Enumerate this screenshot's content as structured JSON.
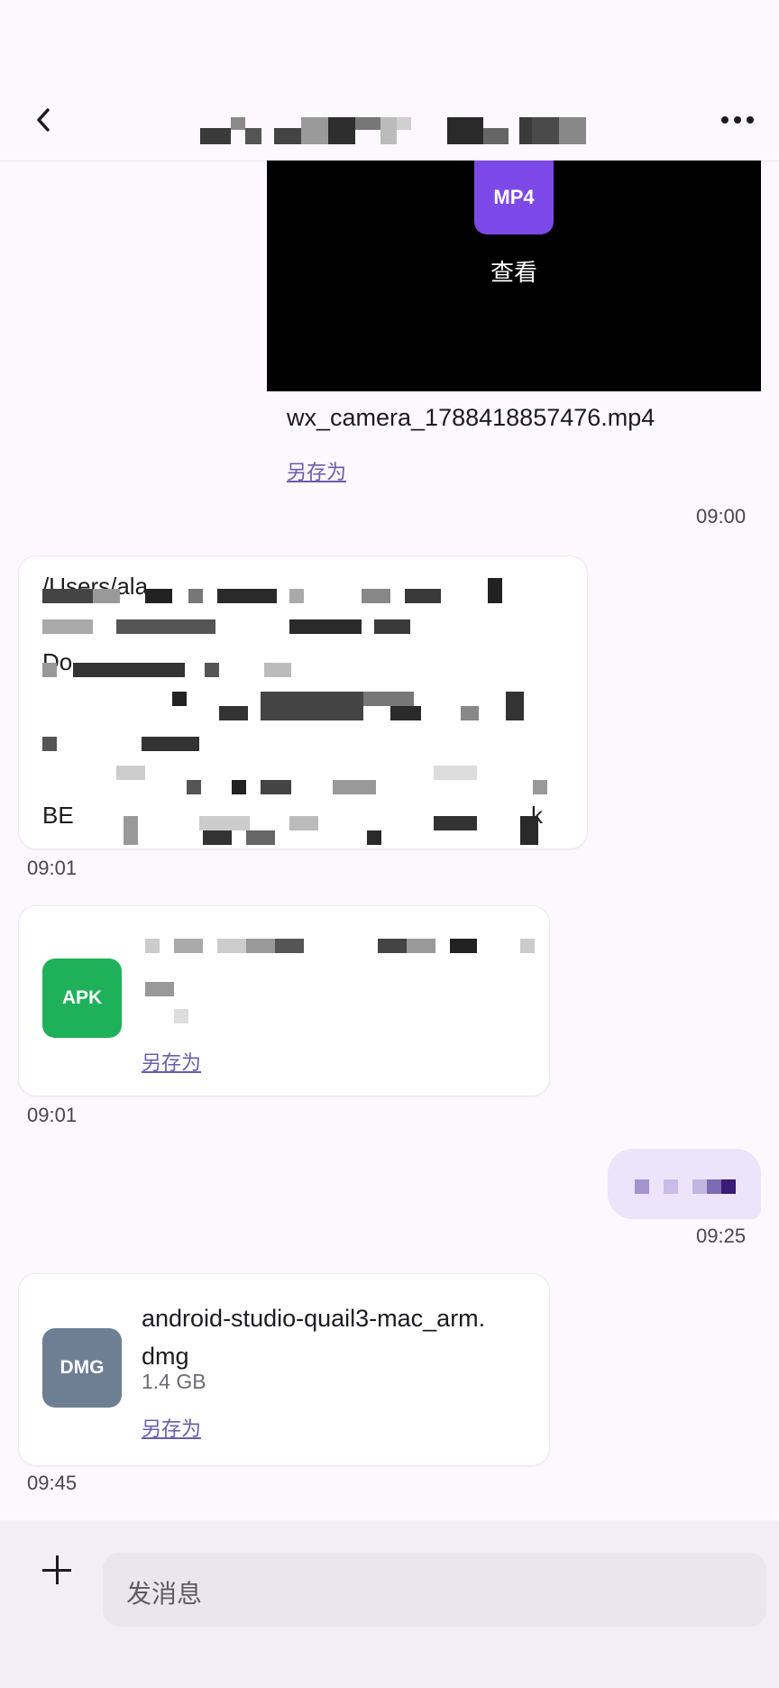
{
  "header": {
    "back_icon": "chevron-left-icon",
    "more_icon": "more-horizontal-icon",
    "title_redacted": true
  },
  "messages": {
    "video": {
      "badge": "MP4",
      "view_label": "查看",
      "filename": "wx_camera_1788418857476.mp4",
      "save_as": "另存为",
      "time": "09:00"
    },
    "path_text": {
      "visible_fragments": [
        "/Users/ala",
        "Do",
        "BE",
        "k"
      ],
      "time": "09:01"
    },
    "apk_file": {
      "badge": "APK",
      "save_as": "另存为",
      "time": "09:01"
    },
    "outgoing": {
      "time": "09:25"
    },
    "dmg_file": {
      "badge": "DMG",
      "filename": "android-studio-quail3-mac_arm.dmg",
      "filename_line1": "android-studio-quail3-mac_arm.",
      "filename_line2": "dmg",
      "size": "1.4 GB",
      "save_as": "另存为",
      "time": "09:45"
    }
  },
  "composer": {
    "placeholder": "发消息",
    "add_icon": "plus-icon"
  },
  "colors": {
    "mp4_badge": "#7c49e8",
    "apk_badge": "#1fb15a",
    "dmg_badge": "#6e7f94",
    "link": "#6b5cad",
    "outgoing_bubble": "#ebe4fb"
  }
}
